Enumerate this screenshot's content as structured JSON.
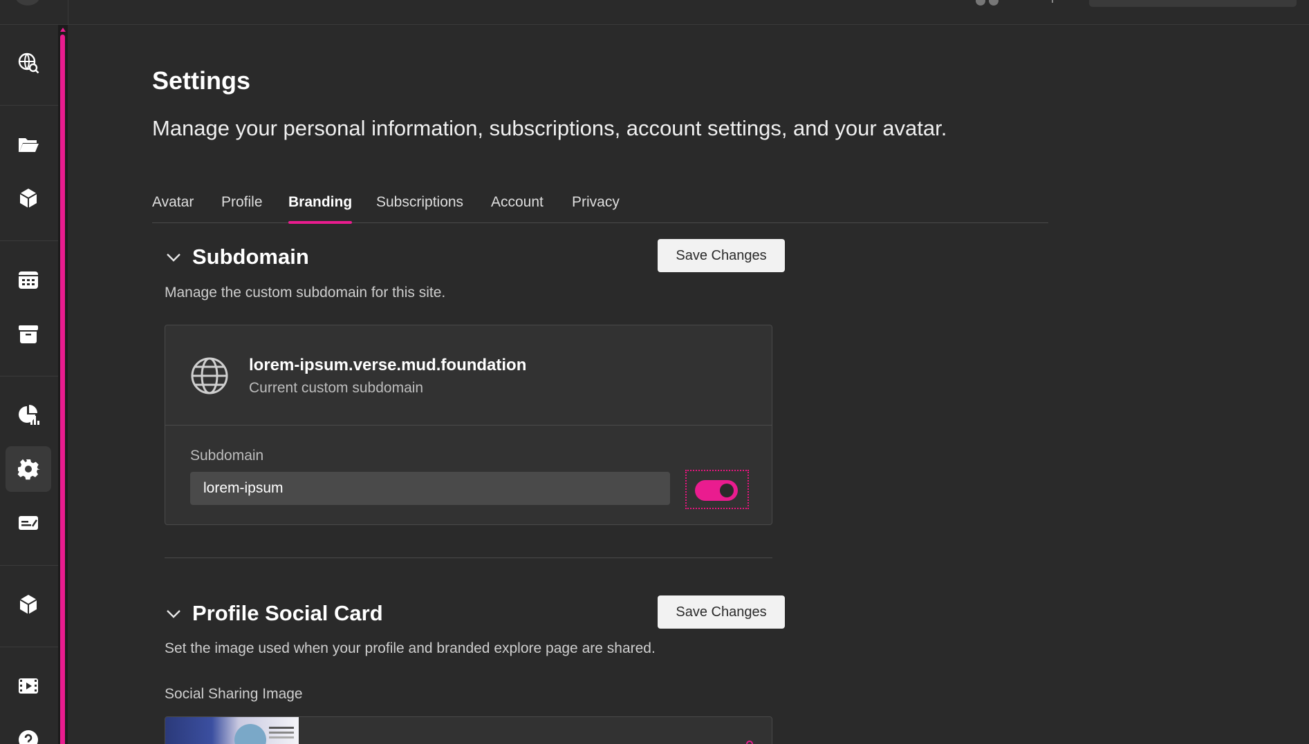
{
  "settings": {
    "title": "Settings",
    "subtitle": "Manage your personal information, subscriptions, account settings, and your avatar."
  },
  "tabs": [
    {
      "label": "Avatar"
    },
    {
      "label": "Profile"
    },
    {
      "label": "Branding",
      "active": true
    },
    {
      "label": "Subscriptions"
    },
    {
      "label": "Account"
    },
    {
      "label": "Privacy"
    }
  ],
  "subdomain": {
    "title": "Subdomain",
    "description": "Manage the custom subdomain for this site.",
    "save_label": "Save Changes",
    "current_value": "lorem-ipsum.verse.mud.foundation",
    "current_caption": "Current custom subdomain",
    "field_label": "Subdomain",
    "input_value": "lorem-ipsum",
    "toggle_on": true
  },
  "social_card": {
    "title": "Profile Social Card",
    "description": "Set the image used when your profile and branded explore page are shared.",
    "save_label": "Save Changes",
    "image_label": "Social Sharing Image"
  },
  "sidebar_icons": [
    "globe-search-icon",
    "folder-icon",
    "cube-icon",
    "calendar-icon",
    "archive-icon",
    "chart-icon",
    "gear-icon",
    "id-card-icon",
    "cube-icon",
    "video-icon",
    "help-icon"
  ],
  "colors": {
    "accent": "#ea1c8f",
    "background": "#2a2a2a",
    "card": "#323232"
  }
}
